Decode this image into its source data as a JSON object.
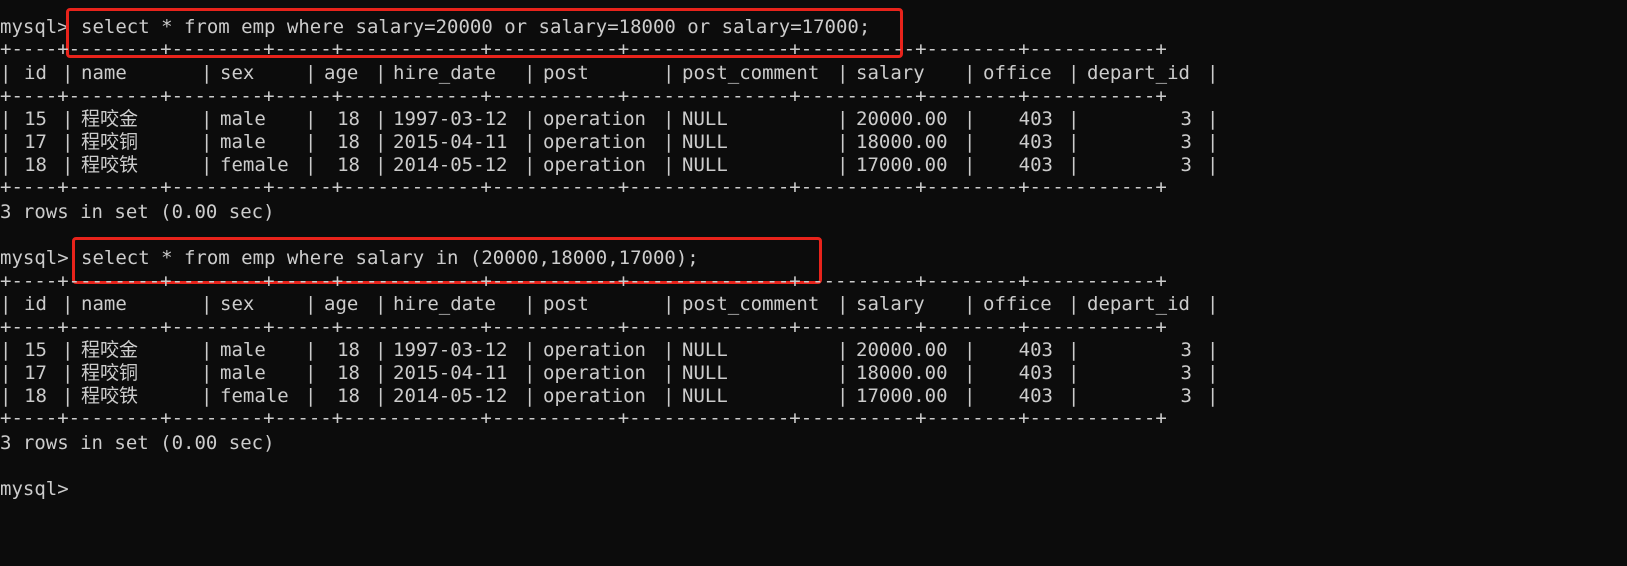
{
  "prompt": "mysql>",
  "queries": [
    {
      "command": "select * from emp where salary=20000 or salary=18000 or salary=17000;",
      "footer": "3 rows in set (0.00 sec)"
    },
    {
      "command": "select * from emp where salary in (20000,18000,17000);",
      "footer": "3 rows in set (0.00 sec)"
    }
  ],
  "columns": [
    "id",
    "name",
    "sex",
    "age",
    "hire_date",
    "post",
    "post_comment",
    "salary",
    "office",
    "depart_id"
  ],
  "rows": [
    [
      "15",
      "程咬金",
      "male",
      "18",
      "1997-03-12",
      "operation",
      "NULL",
      "20000.00",
      "403",
      "3"
    ],
    [
      "17",
      "程咬铜",
      "male",
      "18",
      "2015-04-11",
      "operation",
      "NULL",
      "18000.00",
      "403",
      "3"
    ],
    [
      "18",
      "程咬铁",
      "female",
      "18",
      "2014-05-12",
      "operation",
      "NULL",
      "17000.00",
      "403",
      "3"
    ]
  ],
  "final_prompt": "mysql>",
  "colors": {
    "background": "#0c0c0c",
    "text": "#cccccc",
    "highlight": "#e8231b"
  }
}
